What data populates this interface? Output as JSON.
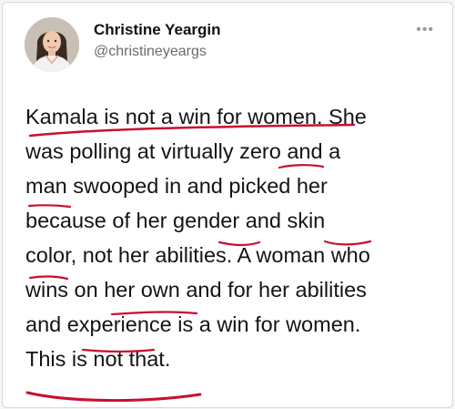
{
  "post": {
    "author_name": "Christine Yeargin",
    "author_handle": "@christineyeargs",
    "more_icon": "more-horizontal-icon",
    "lines": [
      "Kamala is not a win for women. She",
      "was polling at virtually zero and a",
      "man swooped in and picked her",
      "because of her gender and skin",
      "color, not her abilities. A woman who",
      "wins on her own and for her abilities",
      "and experience is a win for women.",
      "This is not that."
    ]
  },
  "colors": {
    "underline_ink": "#c8102e",
    "text": "#141414",
    "handle": "#6b6b6b"
  }
}
